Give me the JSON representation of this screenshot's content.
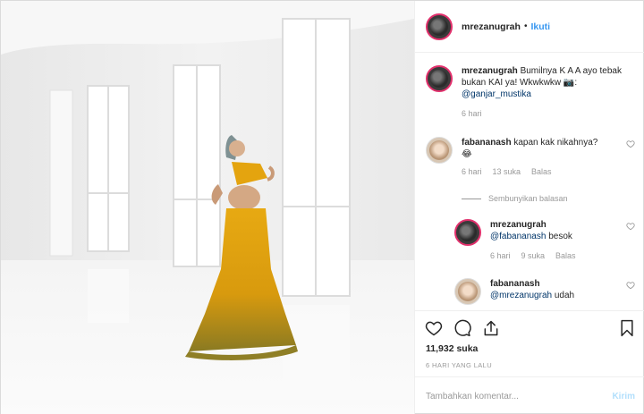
{
  "photo": {
    "description_icon": "photo-placeholder"
  },
  "header": {
    "username": "mrezanugrah",
    "separator": "•",
    "follow_label": "Ikuti"
  },
  "caption": {
    "username": "mrezanugrah",
    "text": "Bumilnya K A A ayo tebak bukan KAI ya! Wkwkwkw 📷:",
    "mention": "@ganjar_mustika",
    "time": "6 hari"
  },
  "comments": [
    {
      "username": "fabananash",
      "text": "kapan kak nikahnya?",
      "emoji": "😂",
      "time": "6 hari",
      "likes": "13 suka",
      "reply_label": "Balas"
    }
  ],
  "hide_replies_label": "Sembunyikan balasan",
  "replies": [
    {
      "username": "mrezanugrah",
      "mention": "@fabananash",
      "text": "besok",
      "time": "6 hari",
      "likes": "9 suka",
      "reply_label": "Balas"
    },
    {
      "username": "fabananash",
      "mention": "@mrezanugrah",
      "text": "udah"
    }
  ],
  "actions": {
    "likes_count": "11,932 suka",
    "timestamp": "6 HARI YANG LALU"
  },
  "add_comment": {
    "placeholder": "Tambahkan komentar...",
    "post_label": "Kirim"
  },
  "colors": {
    "accent": "#3897f0",
    "post_disabled": "#b2dffc",
    "story_ring": "#e1306c"
  }
}
